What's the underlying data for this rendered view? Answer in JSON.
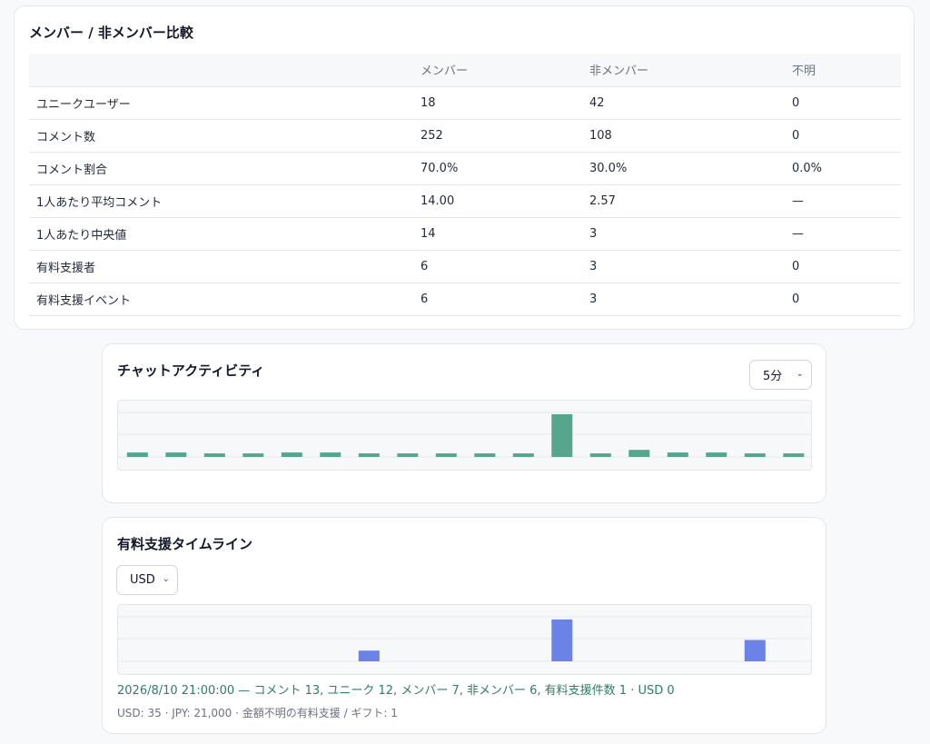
{
  "comparison": {
    "title": "メンバー / 非メンバー比較",
    "headers": [
      "",
      "メンバー",
      "非メンバー",
      "不明"
    ],
    "rows": [
      [
        "ユニークユーザー",
        "18",
        "42",
        "0"
      ],
      [
        "コメント数",
        "252",
        "108",
        "0"
      ],
      [
        "コメント割合",
        "70.0%",
        "30.0%",
        "0.0%"
      ],
      [
        "1人あたり平均コメント",
        "14.00",
        "2.57",
        "—"
      ],
      [
        "1人あたり中央値",
        "14",
        "3",
        "—"
      ],
      [
        "有料支援者",
        "6",
        "3",
        "0"
      ],
      [
        "有料支援イベント",
        "6",
        "3",
        "0"
      ]
    ]
  },
  "chat_activity": {
    "title": "チャットアクティビティ",
    "interval_select": "5分",
    "chevron_icon": "chevron-down-icon"
  },
  "paid_support": {
    "title": "有料支援タイムライン",
    "currency_select": "USD",
    "chevron_icon": "chevron-down-icon",
    "caption": "2026/8/10 21:00:00 — コメント 13, ユニーク 12, メンバー 7, 非メンバー 6, 有料支援件数 1 · USD 0",
    "summary": "USD: 35 · JPY: 21,000 · 金額不明の有料支援 / ギフト: 1"
  },
  "colors": {
    "activity_bar": "#55a68b",
    "support_bar": "#6b82e6",
    "grid": "#e5e7eb"
  },
  "chart_data": [
    {
      "type": "bar",
      "name": "chat-activity",
      "values": [
        5,
        5,
        4,
        4,
        5,
        5,
        4,
        4,
        4,
        4,
        4,
        48,
        4,
        8,
        5,
        5,
        4,
        4
      ],
      "ylim": [
        0,
        60
      ],
      "grid": true
    },
    {
      "type": "bar",
      "name": "paid-support",
      "values": [
        0,
        0,
        0,
        0,
        0,
        0,
        12,
        0,
        0,
        0,
        0,
        47,
        0,
        0,
        0,
        0,
        24,
        0
      ],
      "ylim": [
        0,
        60
      ],
      "grid": true
    }
  ]
}
